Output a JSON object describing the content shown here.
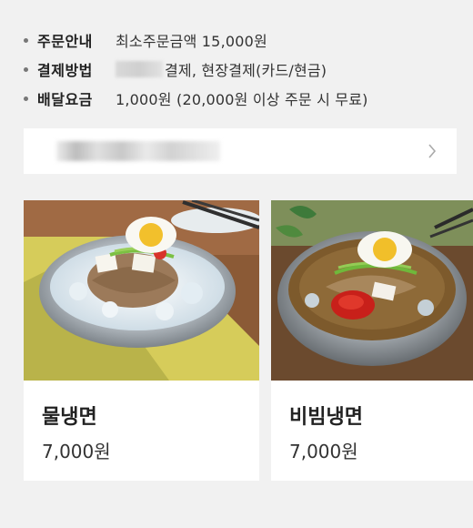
{
  "store_info": {
    "items": [
      {
        "label": "주문안내",
        "value": "최소주문금액 15,000원"
      },
      {
        "label": "결제방법",
        "value": "결제, 현장결제(카드/현금)"
      },
      {
        "label": "배달요금",
        "value": "1,000원 (20,000원 이상 주문 시 무료)"
      }
    ]
  },
  "notice": {
    "icon": "chevron-right-icon"
  },
  "menu": [
    {
      "name": "물냉면",
      "price": "7,000원"
    },
    {
      "name": "비빔냉면",
      "price": "7,000원"
    }
  ],
  "colors": {
    "background": "#f1f1f1",
    "card": "#ffffff",
    "text": "#333333",
    "chevron": "#aaaaaa"
  }
}
